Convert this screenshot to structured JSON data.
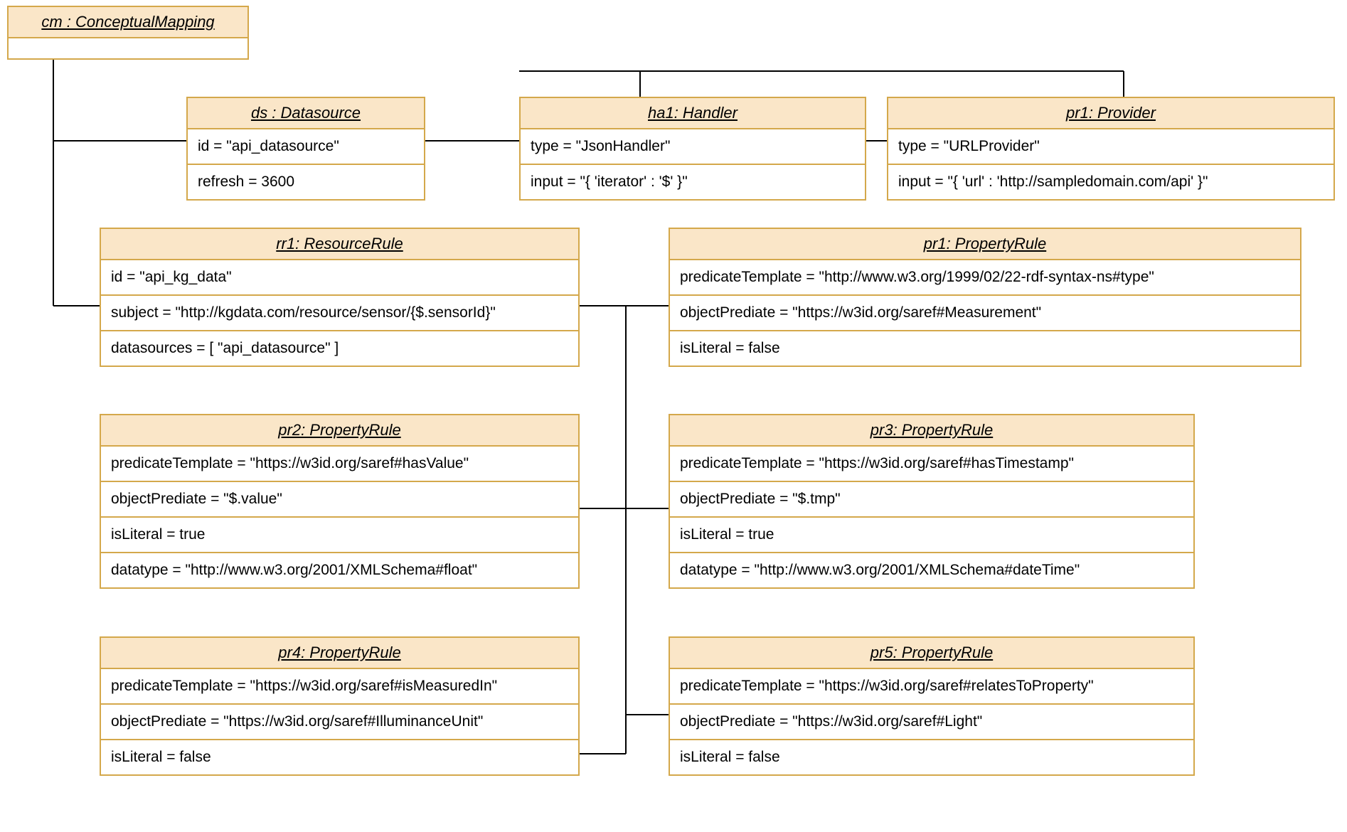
{
  "cm": {
    "title": "cm : ConceptualMapping"
  },
  "ds": {
    "title": "ds : Datasource",
    "id": "id = \"api_datasource\"",
    "refresh": "refresh = 3600"
  },
  "ha1": {
    "title": "ha1: Handler",
    "type": "type = \"JsonHandler\"",
    "input": "input = \"{ 'iterator' : '$' }\""
  },
  "pr1prov": {
    "title": "pr1: Provider",
    "type": "type = \"URLProvider\"",
    "input": "input = \"{ 'url' : 'http://sampledomain.com/api' }\""
  },
  "rr1": {
    "title": "rr1: ResourceRule",
    "id": "id = \"api_kg_data\"",
    "subject": "subject = \"http://kgdata.com/resource/sensor/{$.sensorId}\"",
    "datasources": "datasources = [ \"api_datasource\" ]"
  },
  "pr1rule": {
    "title": "pr1: PropertyRule",
    "predicate": "predicateTemplate = \"http://www.w3.org/1999/02/22-rdf-syntax-ns#type\"",
    "object": "objectPrediate = \"https://w3id.org/saref#Measurement\"",
    "literal": "isLiteral = false"
  },
  "pr2": {
    "title": "pr2: PropertyRule",
    "predicate": "predicateTemplate = \"https://w3id.org/saref#hasValue\"",
    "object": "objectPrediate = \"$.value\"",
    "literal": "isLiteral = true",
    "datatype": "datatype = \"http://www.w3.org/2001/XMLSchema#float\""
  },
  "pr3": {
    "title": "pr3: PropertyRule",
    "predicate": "predicateTemplate = \"https://w3id.org/saref#hasTimestamp\"",
    "object": "objectPrediate = \"$.tmp\"",
    "literal": "isLiteral = true",
    "datatype": "datatype = \"http://www.w3.org/2001/XMLSchema#dateTime\""
  },
  "pr4": {
    "title": "pr4: PropertyRule",
    "predicate": "predicateTemplate = \"https://w3id.org/saref#isMeasuredIn\"",
    "object": "objectPrediate = \"https://w3id.org/saref#IlluminanceUnit\"",
    "literal": "isLiteral = false"
  },
  "pr5": {
    "title": "pr5: PropertyRule",
    "predicate": "predicateTemplate = \"https://w3id.org/saref#relatesToProperty\"",
    "object": "objectPrediate = \"https://w3id.org/saref#Light\"",
    "literal": "isLiteral = false"
  }
}
